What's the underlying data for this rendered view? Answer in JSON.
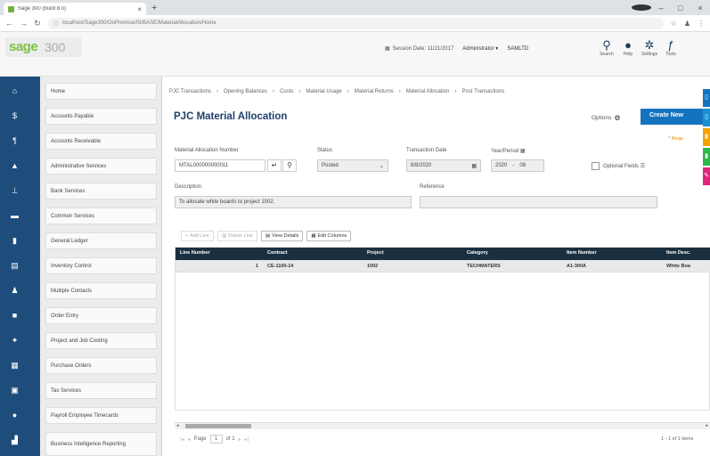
{
  "browser": {
    "tab_title": "Sage 300 (build 8.0)",
    "tab_close": "×",
    "new_tab": "+",
    "url": "localhost/Sage300/OnPremise/SI/BASE/MaterialAllocation/Home",
    "win_min": "–",
    "win_max": "□",
    "win_close": "×"
  },
  "header": {
    "brand": "sage",
    "version": "300",
    "session_date_label": "Session Date: 11/21/2017",
    "user": "Administrator",
    "user_caret": "▾",
    "company": "SAMLTD",
    "icons": [
      {
        "name": "search-icon",
        "glyph": "⚲",
        "label": "Search"
      },
      {
        "name": "help-icon",
        "glyph": "●",
        "label": "Help"
      },
      {
        "name": "settings-icon",
        "glyph": "✲",
        "label": "Settings"
      },
      {
        "name": "tools-icon",
        "glyph": "ƒ",
        "label": "Tools"
      }
    ]
  },
  "sidebar": {
    "items": [
      {
        "label": "Home",
        "icon": "home-icon",
        "glyph": "⌂"
      },
      {
        "label": "Accounts Payable",
        "icon": "payable-icon",
        "glyph": "$"
      },
      {
        "label": "Accounts Receivable",
        "icon": "receivable-icon",
        "glyph": "¶"
      },
      {
        "label": "Administrative Services",
        "icon": "admin-icon",
        "glyph": "▲"
      },
      {
        "label": "Bank Services",
        "icon": "bank-icon",
        "glyph": "⊥"
      },
      {
        "label": "Common Services",
        "icon": "common-icon",
        "glyph": "▬"
      },
      {
        "label": "General Ledger",
        "icon": "ledger-icon",
        "glyph": "▮"
      },
      {
        "label": "Inventory Control",
        "icon": "inventory-icon",
        "glyph": "▤"
      },
      {
        "label": "Multiple Contacts",
        "icon": "contacts-icon",
        "glyph": "♟"
      },
      {
        "label": "Order Entry",
        "icon": "order-icon",
        "glyph": "■"
      },
      {
        "label": "Project and Job Costing",
        "icon": "project-icon",
        "glyph": "✦"
      },
      {
        "label": "Purchase Orders",
        "icon": "purchase-icon",
        "glyph": "▦"
      },
      {
        "label": "Tax Services",
        "icon": "tax-icon",
        "glyph": "▣"
      },
      {
        "label": "Payroll Employee Timecards",
        "icon": "payroll-icon",
        "glyph": "●"
      },
      {
        "label": "Business Intelligence Reporting",
        "icon": "bi-icon",
        "glyph": "▟"
      }
    ]
  },
  "main": {
    "breadcrumb": [
      "PJC Transactions",
      "Opening Balances",
      "Costs",
      "Material Usage",
      "Material Returns",
      "Material Allocation",
      "Post Transactions"
    ],
    "title": "PJC Material Allocation",
    "options_label": "Options",
    "create_new": "Create New",
    "help_note": "* Requ",
    "form": {
      "alloc_number_label": "Material Allocation Number",
      "alloc_number_value": "MTAL000000000011",
      "status_label": "Status",
      "status_value": "Posted",
      "txn_date_label": "Transaction Date",
      "txn_date_value": "8/8/2020",
      "year_period_label": "Year/Period",
      "year_value": "2020",
      "period_value": "08",
      "optional_fields_label": "Optional Fields",
      "description_label": "Description",
      "description_value": "To allocate white boards to project 1002.",
      "reference_label": "Reference",
      "reference_value": ""
    },
    "toolbar": {
      "add_line": "Add Line",
      "delete_line": "Delete Line",
      "view_details": "View Details",
      "edit_columns": "Edit Columns"
    },
    "grid": {
      "columns": [
        "Line Number",
        "Contract",
        "Project",
        "Category",
        "Item Number",
        "Item Desc."
      ],
      "rows": [
        [
          "1",
          "CE-1100-14",
          "1002",
          "TECHMATERS",
          "A1-300A",
          "White Boa"
        ]
      ]
    },
    "pager": {
      "page_label": "Page",
      "page_value": "1",
      "of_label": "of 1",
      "count": "1 - 1 of 1 items"
    }
  },
  "right_tabs": [
    {
      "name": "right-tab-blue-1",
      "color": "#1473bf",
      "glyph": "▯"
    },
    {
      "name": "right-tab-blue-2",
      "color": "#1a8fd1",
      "glyph": "▯"
    },
    {
      "name": "right-tab-orange",
      "color": "#f5a300",
      "glyph": "▮"
    },
    {
      "name": "right-tab-green",
      "color": "#2db84b",
      "glyph": "▮"
    },
    {
      "name": "right-tab-pink",
      "color": "#e0267d",
      "glyph": "✎"
    }
  ],
  "colors": {
    "accent": "#1473bf",
    "sidebar_dark": "#1e4d7c",
    "brand_green": "#7bc142",
    "grid_header": "#1a3040"
  }
}
